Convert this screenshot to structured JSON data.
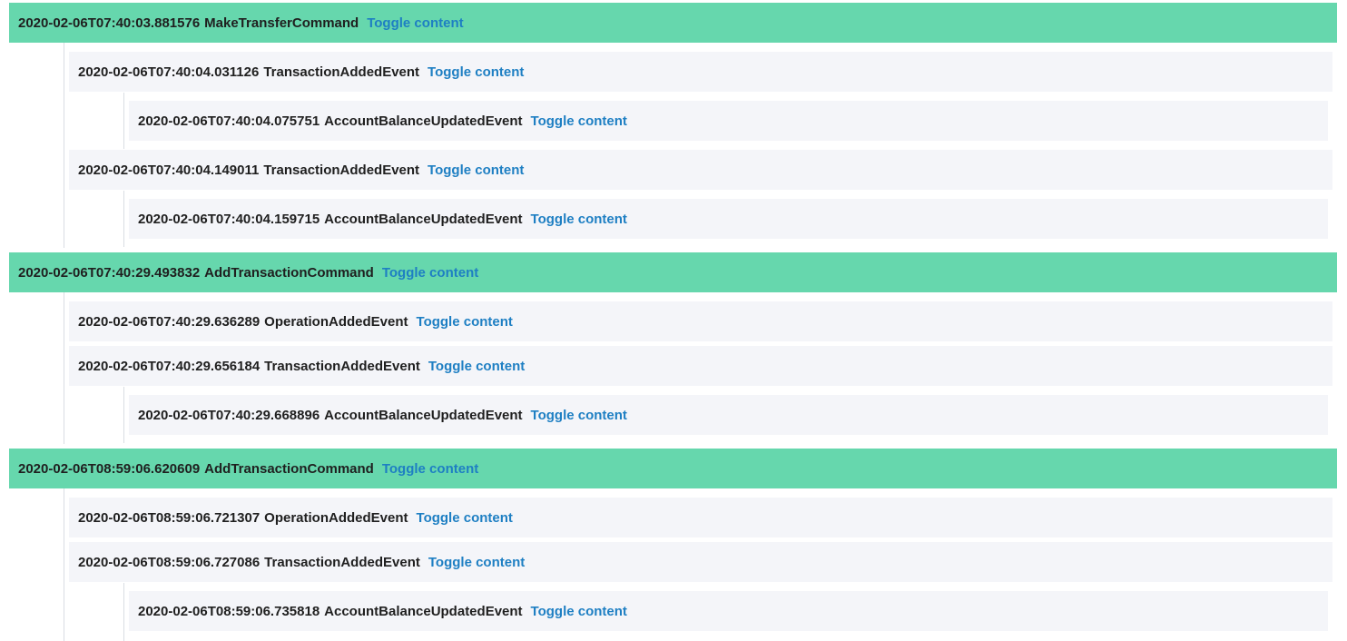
{
  "theme": {
    "command_bg": "#66d7ad",
    "event_bg": "#f4f5f9",
    "link_color": "#1e7fc3"
  },
  "toggle_label": "Toggle content",
  "entries": [
    {
      "timestamp": "2020-02-06T07:40:03.881576",
      "name": "MakeTransferCommand",
      "kind": "command",
      "level": 0
    },
    {
      "timestamp": "2020-02-06T07:40:04.031126",
      "name": "TransactionAddedEvent",
      "kind": "event",
      "level": 1
    },
    {
      "timestamp": "2020-02-06T07:40:04.075751",
      "name": "AccountBalanceUpdatedEvent",
      "kind": "event",
      "level": 2
    },
    {
      "timestamp": "2020-02-06T07:40:04.149011",
      "name": "TransactionAddedEvent",
      "kind": "event",
      "level": 1
    },
    {
      "timestamp": "2020-02-06T07:40:04.159715",
      "name": "AccountBalanceUpdatedEvent",
      "kind": "event",
      "level": 2
    },
    {
      "timestamp": "2020-02-06T07:40:29.493832",
      "name": "AddTransactionCommand",
      "kind": "command",
      "level": 0
    },
    {
      "timestamp": "2020-02-06T07:40:29.636289",
      "name": "OperationAddedEvent",
      "kind": "event",
      "level": 1
    },
    {
      "timestamp": "2020-02-06T07:40:29.656184",
      "name": "TransactionAddedEvent",
      "kind": "event",
      "level": 1
    },
    {
      "timestamp": "2020-02-06T07:40:29.668896",
      "name": "AccountBalanceUpdatedEvent",
      "kind": "event",
      "level": 2
    },
    {
      "timestamp": "2020-02-06T08:59:06.620609",
      "name": "AddTransactionCommand",
      "kind": "command",
      "level": 0
    },
    {
      "timestamp": "2020-02-06T08:59:06.721307",
      "name": "OperationAddedEvent",
      "kind": "event",
      "level": 1
    },
    {
      "timestamp": "2020-02-06T08:59:06.727086",
      "name": "TransactionAddedEvent",
      "kind": "event",
      "level": 1
    },
    {
      "timestamp": "2020-02-06T08:59:06.735818",
      "name": "AccountBalanceUpdatedEvent",
      "kind": "event",
      "level": 2
    }
  ]
}
